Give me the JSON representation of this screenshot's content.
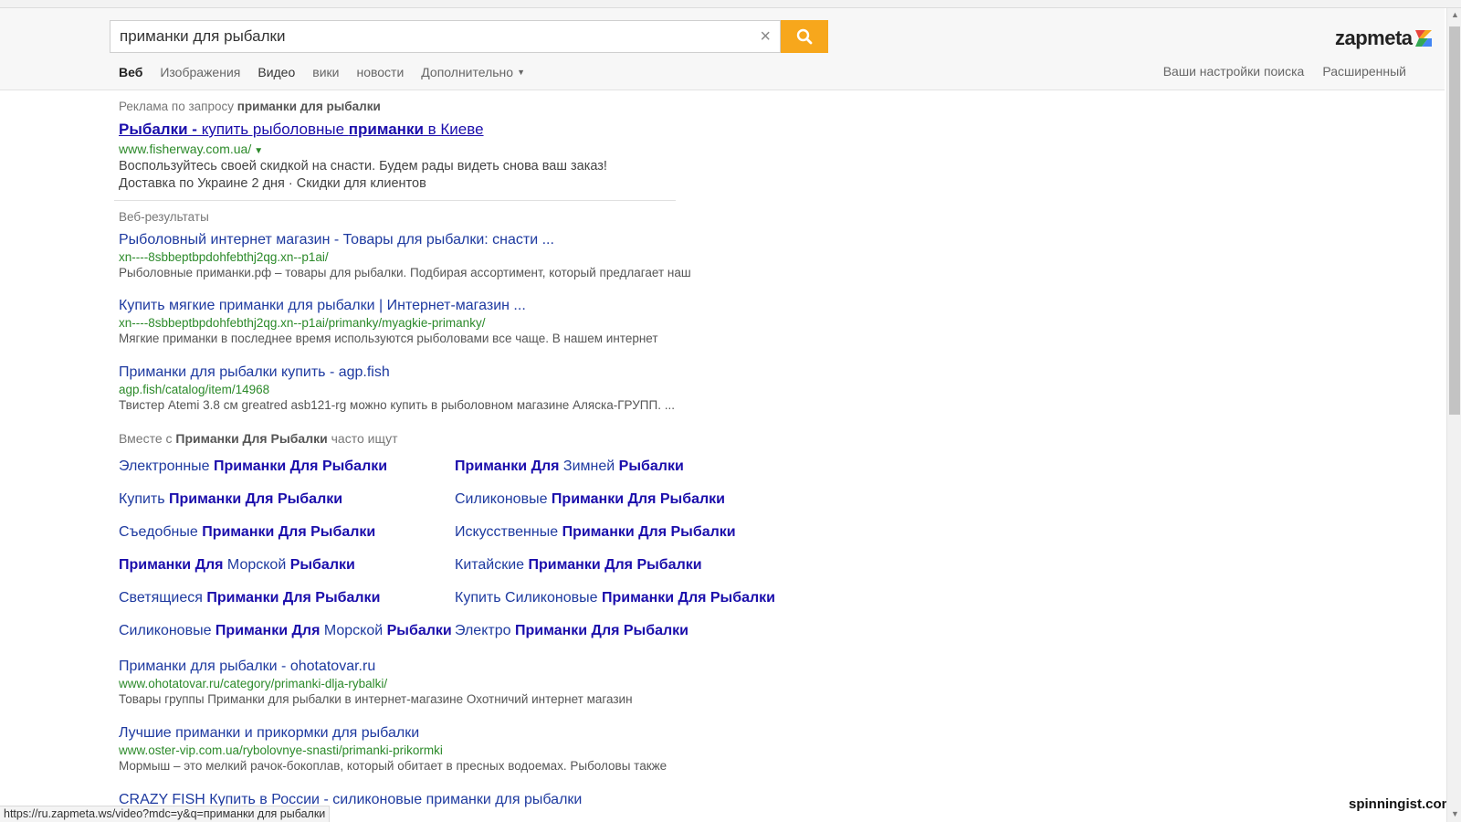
{
  "search": {
    "query": "приманки для рыбалки",
    "clear_glyph": "×",
    "search_icon": "search-icon"
  },
  "logo": {
    "text": "zapmeta"
  },
  "nav": {
    "items": [
      {
        "label": "Веб"
      },
      {
        "label": "Изображения"
      },
      {
        "label": "Видео"
      },
      {
        "label": "вики"
      },
      {
        "label": "новости"
      },
      {
        "label": "Дополнительно"
      }
    ],
    "right": [
      "Ваши настройки поиска",
      "Расширенный"
    ]
  },
  "ad": {
    "label_prefix": "Реклама по запросу",
    "label_query": "приманки для рыбалки",
    "title_part1": "Рыбалки -",
    "title_part2": " купить рыболовные ",
    "title_part3": "приманки",
    "title_part4": " в Киеве",
    "url": "www.fisherway.com.ua/",
    "desc1": "Воспользуйтесь своей скидкой на снасти. Будем рады видеть снова ваш заказ!",
    "desc2": "Доставка по Украине 2 дня · Скидки для клиентов"
  },
  "web_label": "Веб-результаты",
  "results_top": [
    {
      "title": "Рыболовный интернет магазин - Товары для рыбалки: снасти ...",
      "url": "xn----8sbbeptbpdohfebthj2qg.xn--p1ai/",
      "desc": "Рыболовные приманки.рф – товары для рыбалки. Подбирая ассортимент, который предлагает наш"
    },
    {
      "title": "Купить мягкие приманки для рыбалки | Интернет-магазин ...",
      "url": "xn----8sbbeptbpdohfebthj2qg.xn--p1ai/primanky/myagkie-primanky/",
      "desc": "Мягкие приманки в последнее время используются рыболовами все чаще. В нашем интернет"
    },
    {
      "title": "Приманки для рыбалки купить - agp.fish",
      "url": "agp.fish/catalog/item/14968",
      "desc": "Твистер Atemi 3.8 см greatred asb121-rg можно купить в рыболовном магазине Аляска-ГРУПП. ..."
    }
  ],
  "related": {
    "label_prefix": "Вместе с",
    "label_bold": "Приманки Для Рыбалки",
    "label_suffix": "часто ищут",
    "left": [
      {
        "a": "Электронные ",
        "b": "Приманки Для Рыбалки",
        "c": "",
        "d": ""
      },
      {
        "a": "Купить ",
        "b": "Приманки Для Рыбалки",
        "c": "",
        "d": ""
      },
      {
        "a": "Съедобные ",
        "b": "Приманки Для Рыбалки",
        "c": "",
        "d": ""
      },
      {
        "a": "",
        "b": "Приманки Для",
        "c": " Морской ",
        "d": "Рыбалки"
      },
      {
        "a": "Светящиеся ",
        "b": "Приманки Для Рыбалки",
        "c": "",
        "d": ""
      },
      {
        "a": "Силиконовые ",
        "b": "Приманки Для",
        "c": " Морской ",
        "d": "Рыбалки"
      }
    ],
    "right": [
      {
        "a": "",
        "b": "Приманки Для",
        "c": " Зимней ",
        "d": "Рыбалки"
      },
      {
        "a": "Силиконовые ",
        "b": "Приманки Для Рыбалки",
        "c": "",
        "d": ""
      },
      {
        "a": "Искусственные ",
        "b": "Приманки Для Рыбалки",
        "c": "",
        "d": ""
      },
      {
        "a": "Китайские ",
        "b": "Приманки Для Рыбалки",
        "c": "",
        "d": ""
      },
      {
        "a": "Купить Силиконовые ",
        "b": "Приманки Для Рыбалки",
        "c": "",
        "d": ""
      },
      {
        "a": "Электро ",
        "b": "Приманки Для Рыбалки",
        "c": "",
        "d": ""
      }
    ]
  },
  "results_bottom": [
    {
      "title": "Приманки для рыбалки - ohotatovar.ru",
      "url": "www.ohotatovar.ru/category/primanki-dlja-rybalki/",
      "desc": "Товары группы Приманки для рыбалки в интернет-магазине Охотничий интернет магазин"
    },
    {
      "title": "Лучшие приманки и прикормки для рыбалки",
      "url": "www.oster-vip.com.ua/rybolovnye-snasti/primanki-prikormki",
      "desc": "Мормыш – это мелкий рачок-бокоплав, который обитает в пресных водоемах. Рыболовы также"
    },
    {
      "title": "CRAZY FISH Купить в России - силиконовые приманки для рыбалки",
      "url": "",
      "desc": ""
    }
  ],
  "status_bar": "https://ru.zapmeta.ws/video?mdc=y&q=приманки для рыбалки",
  "watermark": "spinningist.com",
  "colors": {
    "accent": "#f7a71c",
    "link": "#1e3aa0",
    "ad_link": "#1a0dab",
    "url_green": "#2c8a2a"
  }
}
